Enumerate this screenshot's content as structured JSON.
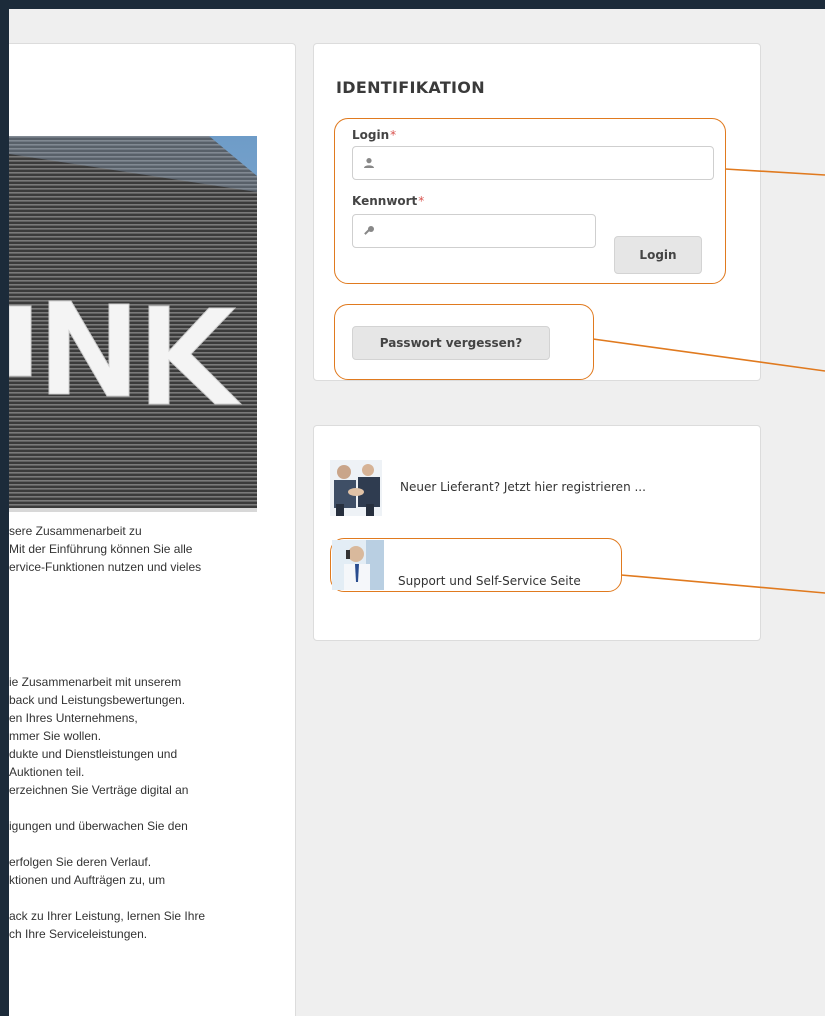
{
  "identification": {
    "title": "IDENTIFIKATION",
    "login_label": "Login",
    "password_label": "Kennwort",
    "required_mark": "*",
    "login_value": "",
    "password_value": "",
    "login_button": "Login",
    "forgot_button": "Passwort vergessen?"
  },
  "links": {
    "new_supplier": "Neuer Lieferant? Jetzt hier registrieren ...",
    "support": "Support und Self-Service Seite"
  },
  "intro": {
    "lines": [
      "sere Zusammenarbeit zu",
      " Mit der Einführung können Sie alle",
      "ervice-Funktionen nutzen und vieles"
    ]
  },
  "features": {
    "lines": [
      "ie Zusammenarbeit mit unserem",
      "back und Leistungsbewertungen.",
      "en Ihres Unternehmens,",
      "mmer Sie wollen.",
      "dukte und Dienstleistungen und",
      "Auktionen teil.",
      "erzeichnen Sie Verträge digital an",
      "igungen und überwachen Sie den",
      "erfolgen Sie deren Verlauf.",
      "ktionen und Aufträgen zu, um",
      "ack zu Ihrer Leistung, lernen Sie Ihre",
      "ch Ihre Serviceleistungen."
    ]
  },
  "banner": {
    "sign_text": "NK"
  },
  "colors": {
    "highlight": "#e07a1f",
    "required": "#d9534f",
    "frame": "#1c2b3a"
  },
  "icons": {
    "user": "user-icon",
    "key": "key-icon"
  }
}
